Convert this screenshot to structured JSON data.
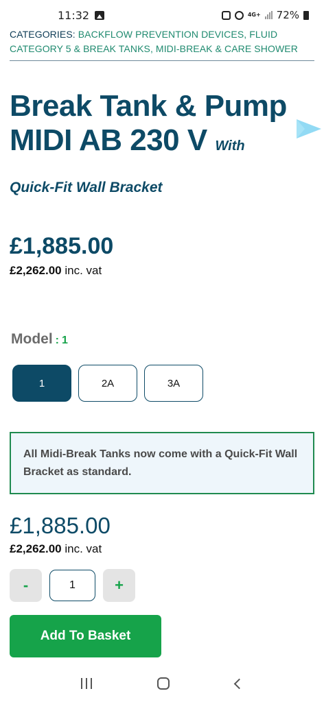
{
  "status_bar": {
    "time": "11:32",
    "battery": "72%",
    "network": "4G+"
  },
  "categories": {
    "prefix": "CATEGORIES: ",
    "links": "BACKFLOW PREVENTION DEVICES, FLUID CATEGORY 5 & BREAK TANKS, MIDI-BREAK & CARE SHOWER"
  },
  "product": {
    "title": "Break Tank & Pump MIDI AB 230 V",
    "title_suffix": "With",
    "subtitle": "Quick-Fit Wall Bracket"
  },
  "price": {
    "amount": "£1,885.00",
    "inc_amount": "£2,262.00",
    "inc_label": " inc. vat"
  },
  "model": {
    "label": "Model",
    "separator": ":",
    "selected_value": "1",
    "options": [
      "1",
      "2A",
      "3A"
    ]
  },
  "notice": {
    "text": "All Midi-Break Tanks now come with a Quick-Fit Wall Bracket as standard."
  },
  "price_bottom": {
    "amount": "£1,885.00",
    "inc_amount": "£2,262.00",
    "inc_label": " inc. vat"
  },
  "quantity": {
    "minus": "-",
    "value": "1",
    "plus": "+"
  },
  "add_to_basket": "Add To Basket",
  "colors": {
    "brand_navy": "#0d4a66",
    "accent_green": "#16a34a",
    "notice_border": "#1f8a4f"
  }
}
